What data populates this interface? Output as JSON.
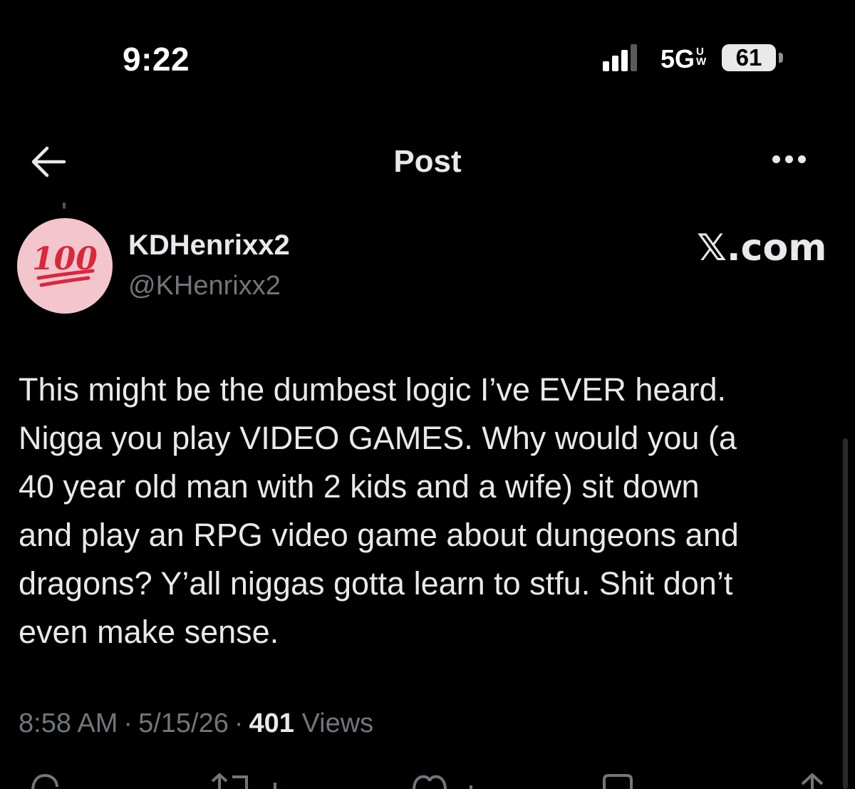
{
  "status_bar": {
    "time": "9:22",
    "network": "5G",
    "network_sub_top": "U",
    "network_sub_bottom": "W",
    "battery": "61"
  },
  "nav": {
    "title": "Post",
    "back_icon": "arrow-left-icon",
    "more_icon": "more-horizontal-icon"
  },
  "author": {
    "display_name": "KDHenrixx2",
    "handle": "@KHenrixx2",
    "avatar_emoji": "100"
  },
  "watermark": "𝕏.com",
  "tweet": {
    "text": "This might be the dumbest logic I’ve EVER heard.\nNigga you play VIDEO GAMES. Why would you (a\n40 year old man with 2 kids and a wife) sit down\nand play an RPG video game about dungeons and\ndragons? Y’all niggas gotta learn to stfu. Shit don’t\neven make sense."
  },
  "meta": {
    "time": "8:58 AM",
    "date": "5/15/26",
    "views_count": "401",
    "views_label": "Views",
    "separator": "·"
  },
  "actions": {
    "icons": [
      "reply-icon",
      "repost-icon",
      "like-icon",
      "bookmark-icon",
      "share-icon"
    ]
  },
  "colors": {
    "background": "#000000",
    "primary_text": "#e7e9ea",
    "secondary_text": "#71767b",
    "avatar_bg": "#f3c6cd",
    "hundred_red": "#d8283c"
  }
}
